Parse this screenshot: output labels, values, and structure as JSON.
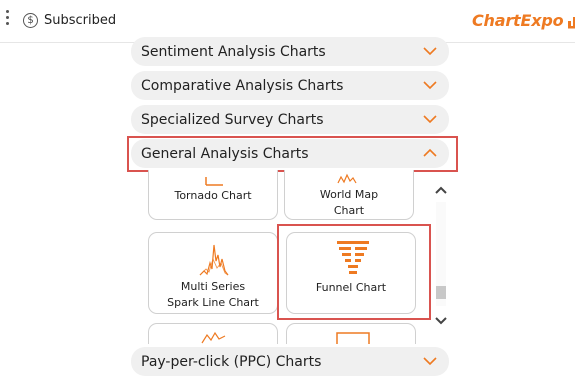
{
  "topbar": {
    "menu_icon": "kebab-menu-icon",
    "subscription_icon": "dollar-circle-icon",
    "subscription_status": "Subscribed",
    "logo_text": "ChartExpo",
    "brand_color": "#ee7a22"
  },
  "sections": [
    {
      "label": "Sentiment Analysis Charts",
      "state": "collapsed"
    },
    {
      "label": "Comparative Analysis Charts",
      "state": "collapsed"
    },
    {
      "label": "Specialized Survey Charts",
      "state": "collapsed"
    },
    {
      "label": "General Analysis Charts",
      "state": "expanded",
      "highlighted": true
    },
    {
      "label": "Pay-per-click (PPC) Charts",
      "state": "collapsed"
    }
  ],
  "chart_cards": [
    {
      "label": "Tornado Chart",
      "icon": "tornado-chart-icon"
    },
    {
      "label": "World Map\nChart",
      "icon": "world-map-chart-icon"
    },
    {
      "label": "Multi Series\nSpark Line Chart",
      "icon": "spark-line-chart-icon"
    },
    {
      "label": "Funnel Chart",
      "icon": "funnel-chart-icon",
      "highlighted": true
    }
  ],
  "colors": {
    "accent": "#ee7a22",
    "highlight_border": "#d9534f",
    "section_bg": "#f0f0f0"
  }
}
